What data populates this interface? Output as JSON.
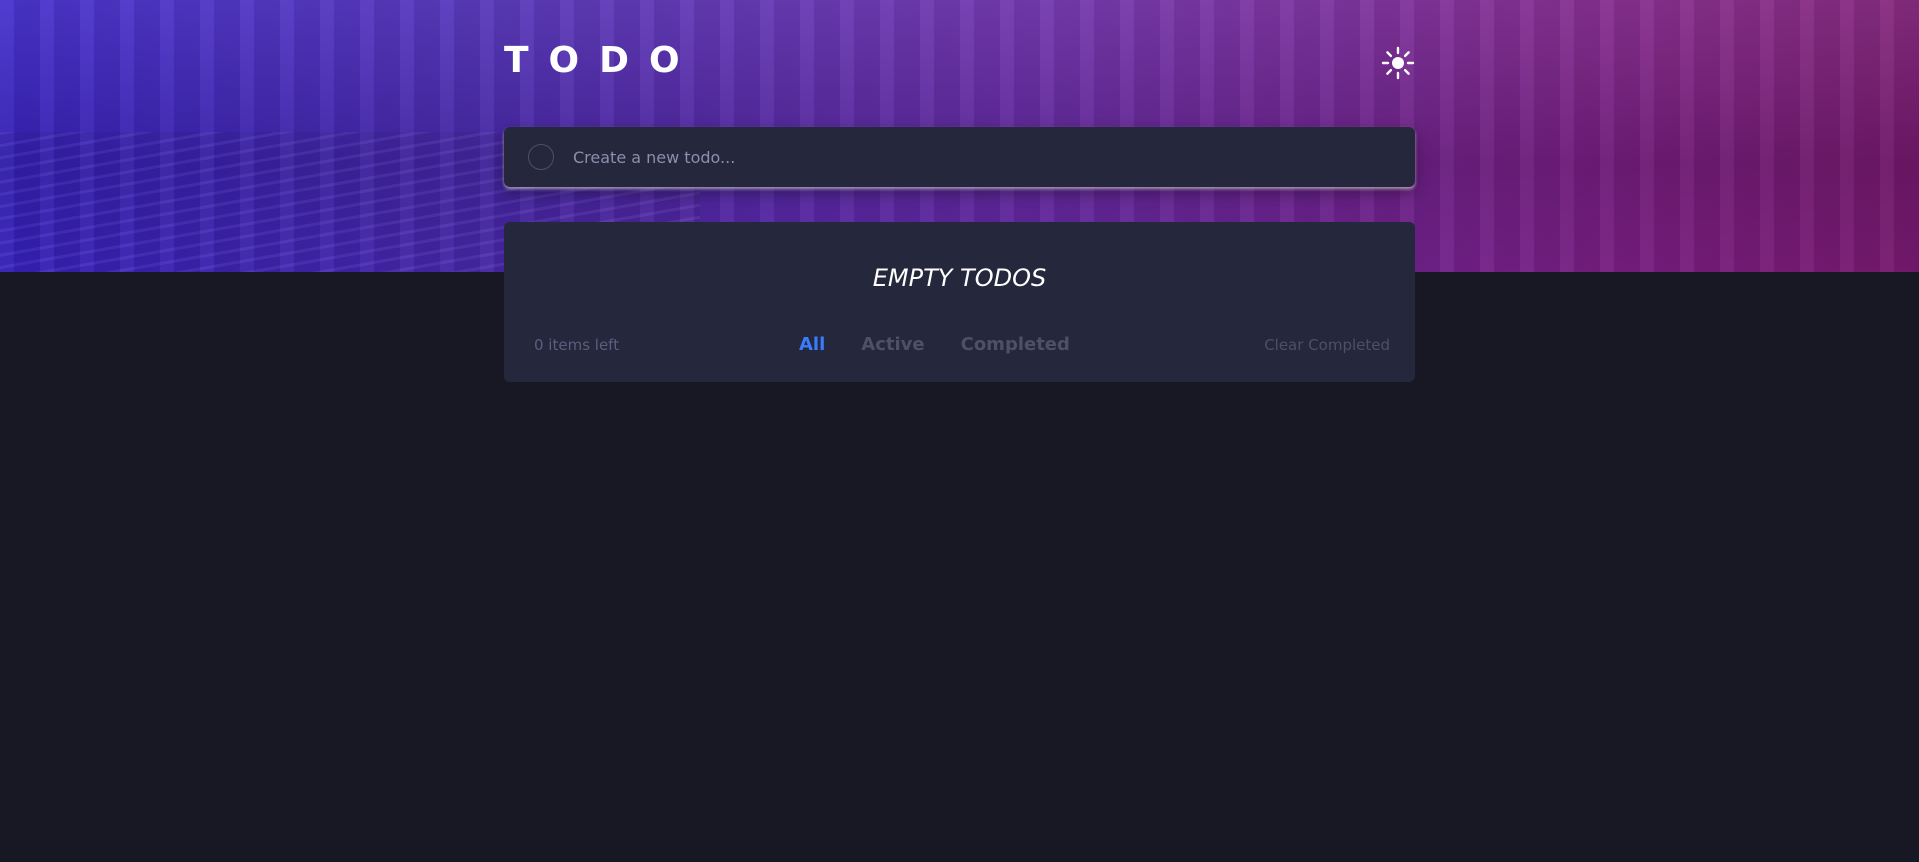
{
  "header": {
    "title": "TODO",
    "theme_toggle_icon": "sun-icon"
  },
  "new_todo": {
    "placeholder": "Create a new todo..."
  },
  "list": {
    "empty_message": "EMPTY TODOS",
    "items_left": "0 items left",
    "filters": [
      {
        "label": "All",
        "active": true
      },
      {
        "label": "Active",
        "active": false
      },
      {
        "label": "Completed",
        "active": false
      }
    ],
    "clear_label": "Clear Completed"
  },
  "colors": {
    "background": "#181824",
    "card": "#25273c",
    "accent": "#3a7cfd",
    "muted": "#4d5066",
    "hero_start": "#3a23c9",
    "hero_end": "#7d1a75"
  }
}
